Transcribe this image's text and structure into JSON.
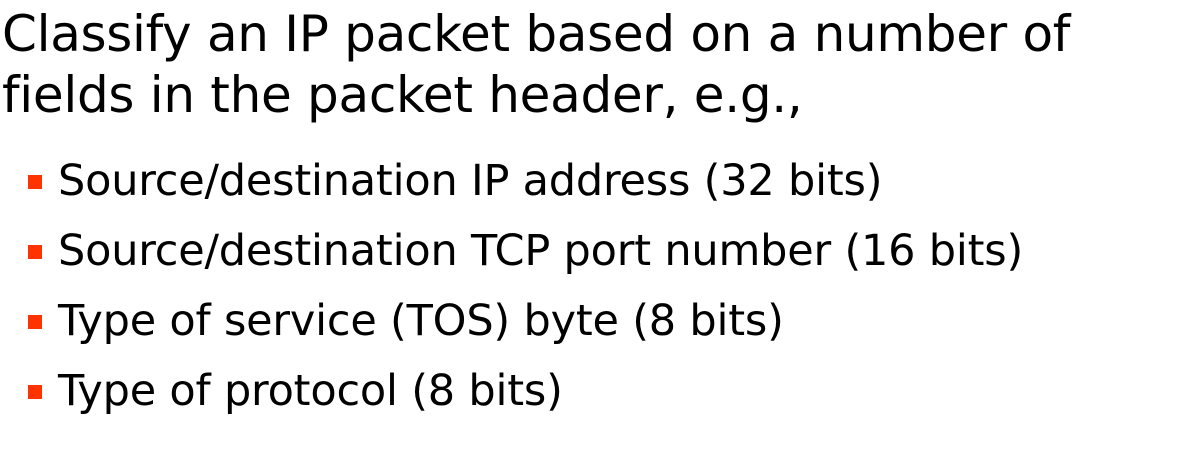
{
  "slide": {
    "intro_lines": [
      "Classify an IP packet based on a number of",
      "fields in the packet header, e.g.,"
    ],
    "bullet_color": "#ff3300",
    "bullets": [
      "Source/destination IP address (32 bits)",
      "Source/destination TCP port number (16 bits)",
      "Type of service (TOS) byte (8 bits)",
      "Type of protocol (8 bits)"
    ]
  }
}
